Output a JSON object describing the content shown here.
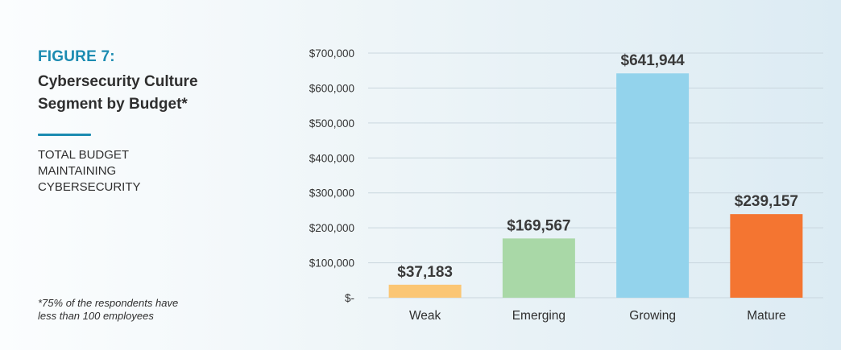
{
  "figure": {
    "label": "FIGURE 7:",
    "title_lines": [
      "Cybersecurity Culture",
      "Segment by Budget*"
    ],
    "subtitle_lines": [
      "TOTAL BUDGET",
      "MAINTAINING",
      "CYBERSECURITY"
    ],
    "footnote_lines": [
      "*75% of the respondents have",
      "less than 100 employees"
    ]
  },
  "colors": {
    "accent": "#1b8bb1",
    "weak": "#fbc674",
    "emerging": "#a9d8a7",
    "growing": "#93d3ec",
    "mature": "#f47531"
  },
  "chart_data": {
    "type": "bar",
    "categories": [
      "Weak",
      "Emerging",
      "Growing",
      "Mature"
    ],
    "values": [
      37183,
      169567,
      641944,
      239157
    ],
    "data_labels": [
      "$37,183",
      "$169,567",
      "$641,944",
      "$239,157"
    ],
    "bar_colors": [
      "#fbc674",
      "#a9d8a7",
      "#93d3ec",
      "#f47531"
    ],
    "ylim": [
      0,
      700000
    ],
    "yticks": [
      0,
      100000,
      200000,
      300000,
      400000,
      500000,
      600000,
      700000
    ],
    "ytick_labels": [
      "$-",
      "$100,000",
      "$200,000",
      "$300,000",
      "$400,000",
      "$500,000",
      "$600,000",
      "$700,000"
    ],
    "grid": true,
    "legend": "none"
  }
}
